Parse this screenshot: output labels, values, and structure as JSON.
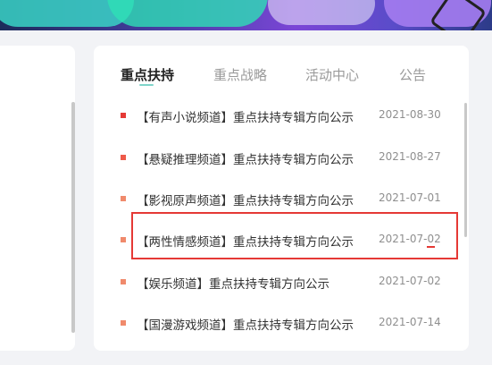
{
  "tabs": [
    {
      "label": "重点扶持",
      "active": true
    },
    {
      "label": "重点战略",
      "active": false
    },
    {
      "label": "活动中心",
      "active": false
    },
    {
      "label": "公告",
      "active": false
    }
  ],
  "items": [
    {
      "title": "【有声小说频道】重点扶持专辑方向公示",
      "date": "2021-08-30",
      "dot_color": "#e53935"
    },
    {
      "title": "【悬疑推理频道】重点扶持专辑方向公示",
      "date": "2021-08-27",
      "dot_color": "#ee5a4a"
    },
    {
      "title": "【影视原声频道】重点扶持专辑方向公示",
      "date": "2021-07-01",
      "dot_color": "#f08a6c"
    },
    {
      "title": "【两性情感频道】重点扶持专辑方向公示",
      "date": "2021-07-02",
      "dot_color": "#f08a6c"
    },
    {
      "title": "【娱乐频道】重点扶持专辑方向公示",
      "date": "2021-07-02",
      "dot_color": "#f08a6c"
    },
    {
      "title": "【国漫游戏频道】重点扶持专辑方向公示",
      "date": "2021-07-14",
      "dot_color": "#f08a6c"
    }
  ],
  "colors": {
    "accent_underline": "#7fd4c9",
    "highlight_border": "#e53935"
  }
}
